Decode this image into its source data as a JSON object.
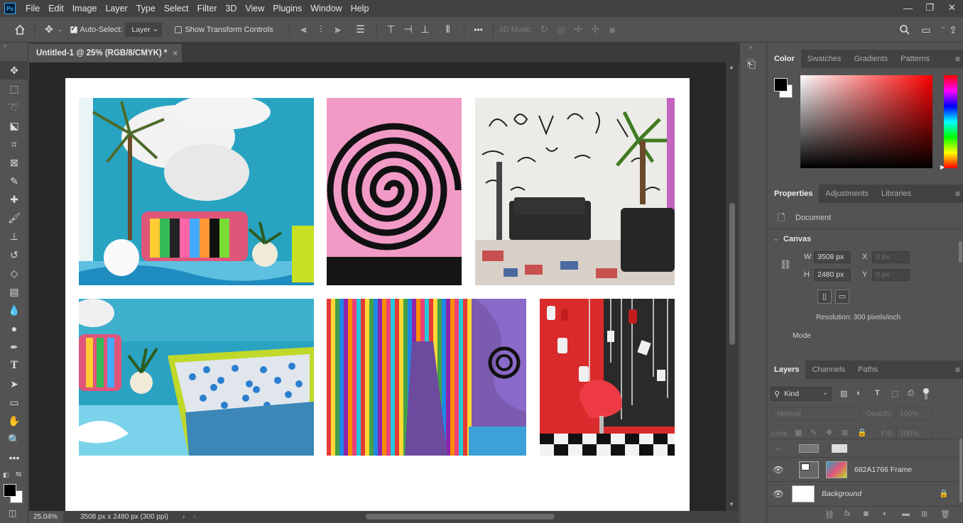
{
  "app": {
    "logo": "Ps"
  },
  "menu": [
    "File",
    "Edit",
    "Image",
    "Layer",
    "Type",
    "Select",
    "Filter",
    "3D",
    "View",
    "Plugins",
    "Window",
    "Help"
  ],
  "window_controls": {
    "minimize": "—",
    "restore": "❐",
    "close": "✕"
  },
  "options_bar": {
    "auto_select_label": "Auto-Select:",
    "auto_select_checked": true,
    "auto_select_target": "Layer",
    "transform_controls_label": "Show Transform Controls",
    "transform_controls_checked": false,
    "more_label": "•••",
    "mode_3d_label": "3D Mode:"
  },
  "document": {
    "tab_title": "Untitled-1 @ 25% (RGB/8/CMYK) *",
    "close_glyph": "×",
    "zoom": "25.04%",
    "status_info": "3508 px x 2480 px (300 ppi)"
  },
  "color_panel": {
    "tabs": [
      "Color",
      "Swatches",
      "Gradients",
      "Patterns"
    ],
    "active_tab": "Color",
    "foreground_color": "#000000",
    "background_color": "#ffffff"
  },
  "properties_panel": {
    "tabs": [
      "Properties",
      "Adjustments",
      "Libraries"
    ],
    "active_tab": "Properties",
    "doc_label": "Document",
    "section_title": "Canvas",
    "w_label": "W",
    "w_value": "3508 px",
    "h_label": "H",
    "h_value": "2480 px",
    "x_label": "X",
    "x_placeholder": "0 px",
    "y_label": "Y",
    "y_placeholder": "0 px",
    "resolution": "Resolution: 300 pixels/inch",
    "mode_label": "Mode"
  },
  "layers_panel": {
    "tabs": [
      "Layers",
      "Channels",
      "Paths"
    ],
    "active_tab": "Layers",
    "filter_kind": "Kind",
    "blend_mode": "Normal",
    "opacity_label": "Opacity:",
    "opacity_value": "100%",
    "lock_label": "Lock:",
    "fill_label": "Fill:",
    "fill_value": "100%",
    "layers": [
      {
        "name": "",
        "visible": false
      },
      {
        "name": "682A1766 Frame",
        "visible": true
      },
      {
        "name": "Background",
        "visible": true,
        "locked": true
      }
    ]
  }
}
